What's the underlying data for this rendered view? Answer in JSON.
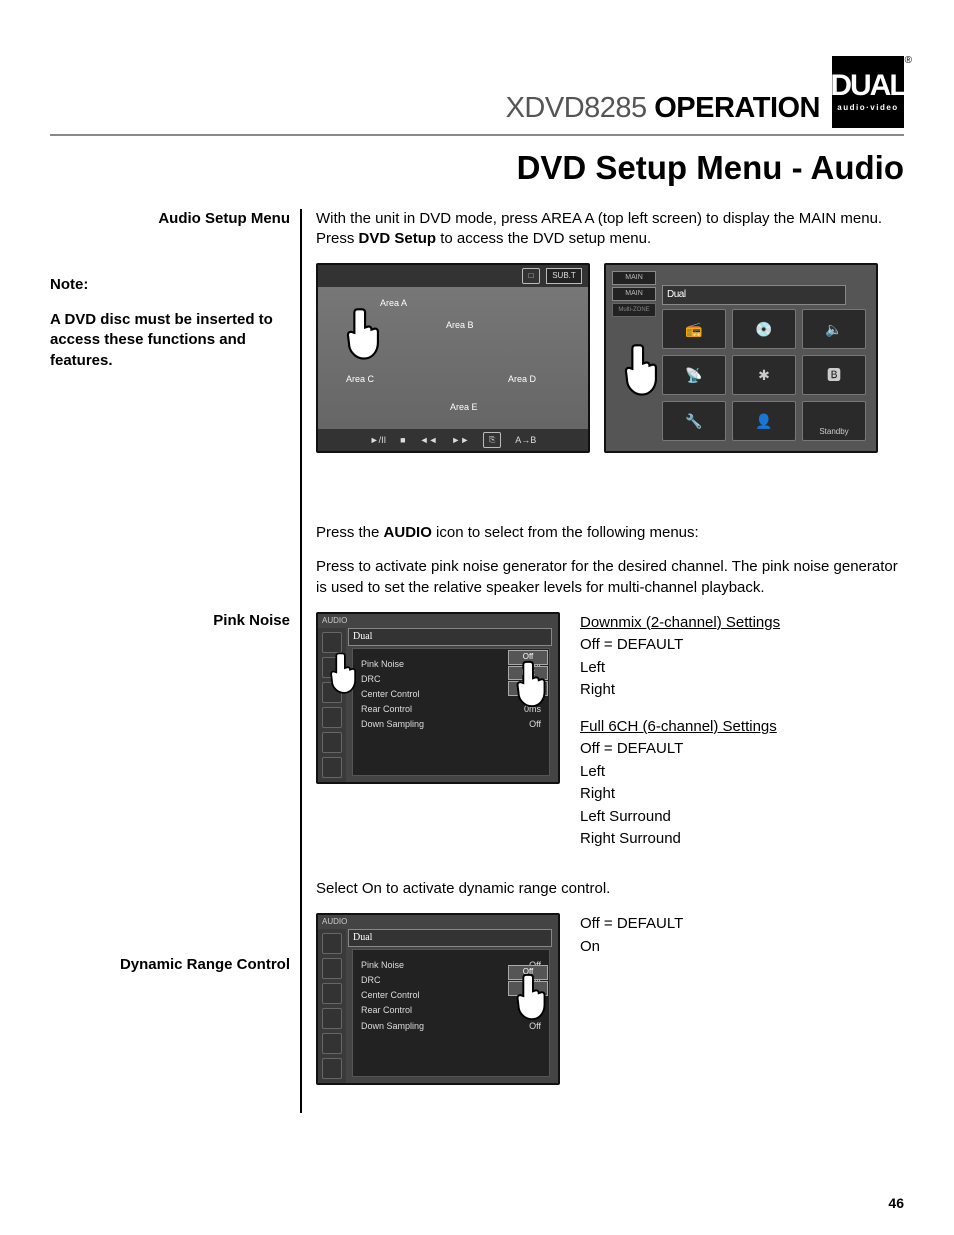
{
  "header": {
    "model": "XDVD8285",
    "word": "OPERATION",
    "logo_text": "DUAL",
    "logo_sub": "audio·video",
    "reg": "®"
  },
  "page_title": "DVD Setup Menu - Audio",
  "labels": {
    "audio_setup": "Audio Setup Menu",
    "note_h": "Note:",
    "note_b": "A DVD disc must be inserted to access these functions and features.",
    "pink_noise": "Pink Noise",
    "drc": "Dynamic Range Control"
  },
  "intro": {
    "p1a": "With the unit in DVD mode, press AREA A (top left screen) to display the MAIN menu. Press ",
    "p1b": "DVD Setup",
    "p1c": " to access the DVD setup menu.",
    "p2a": "Press the ",
    "p2b": "AUDIO",
    "p2c": " icon to select from the following menus:"
  },
  "dvd_shot": {
    "subt": "SUB.T",
    "areas": {
      "a": "Area A",
      "b": "Area B",
      "c": "Area C",
      "d": "Area D",
      "e": "Area E"
    },
    "ctrls": {
      "play": "►/II",
      "stop": "■",
      "rev": "◄◄",
      "fwd": "►►",
      "ab": "A→B"
    }
  },
  "menu_shot": {
    "main": "MAIN",
    "mz": "Multi-ZONE",
    "dual": "Dual",
    "standby": "Standby",
    "icons": [
      "📻",
      "💿",
      "🔈",
      "📡",
      "✱",
      "🅱",
      "🔧",
      "👤",
      "🖵"
    ]
  },
  "pink": {
    "desc": "Press to activate pink noise generator for the desired channel. The pink noise generator is used to set the relative speaker levels for multi-channel playback.",
    "shot": {
      "hdr": "AUDIO",
      "dual": "Dual",
      "rows": [
        {
          "k": "Pink Noise",
          "v": "Off"
        },
        {
          "k": "DRC",
          "v": "Off"
        },
        {
          "k": "Center Control",
          "v": "0ms"
        },
        {
          "k": "Rear  Control",
          "v": "0ms"
        },
        {
          "k": "Down  Sampling",
          "v": "Off"
        }
      ],
      "dd": [
        "Off",
        "Left",
        "Right"
      ]
    },
    "settings": {
      "h1": "Downmix (2-channel) Settings",
      "l1": [
        "Off = DEFAULT",
        "Left",
        "Right"
      ],
      "h2": "Full 6CH (6-channel) Settings",
      "l2": [
        "Off = DEFAULT",
        "Left",
        "Right",
        "Left Surround",
        "Right Surround"
      ]
    }
  },
  "drc": {
    "desc": "Select On to activate dynamic range control.",
    "shot": {
      "hdr": "AUDIO",
      "dual": "Dual",
      "rows": [
        {
          "k": "Pink Noise",
          "v": "Off"
        },
        {
          "k": "DRC",
          "v": "Off"
        },
        {
          "k": "Center Control",
          "v": "0ms"
        },
        {
          "k": "Rear  Control",
          "v": "0ms"
        },
        {
          "k": "Down  Sampling",
          "v": "Off"
        }
      ],
      "dd": [
        "Off",
        "On"
      ]
    },
    "settings": [
      "Off = DEFAULT",
      "On"
    ]
  },
  "page_num": "46"
}
